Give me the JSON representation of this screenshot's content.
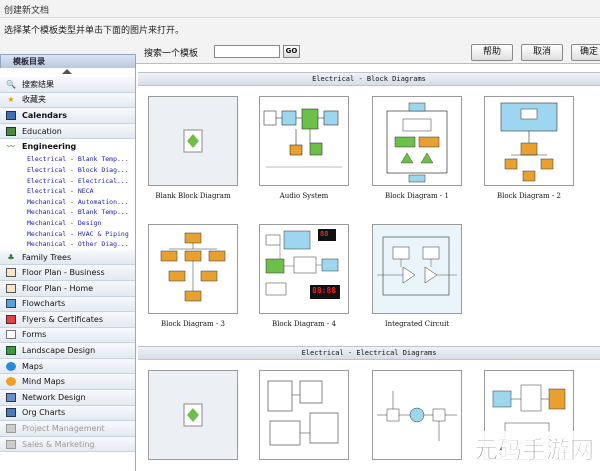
{
  "window": {
    "title": "创建新文档",
    "instruction": "选择某个模板类型并单击下面的图片来打开。"
  },
  "toolbar": {
    "template_dir_label": "模板目录",
    "search_label": "搜索一个模板",
    "search_value": "",
    "go_label": "GO",
    "help_label": "帮助",
    "cancel_label": "取消",
    "ok_label": "确定"
  },
  "sidebar": {
    "top_items": [
      {
        "label": "搜索结果",
        "icon": "magnifier-icon"
      },
      {
        "label": "收藏夹",
        "icon": "star-icon"
      },
      {
        "label": "Calendars",
        "icon": "calendar-icon"
      },
      {
        "label": "Education",
        "icon": "book-icon"
      }
    ],
    "engineering_label": "Engineering",
    "engineering_children": [
      "Electrical - Blank Temp...",
      "Electrical - Block Diag...",
      "Electrical - Electrical...",
      "Electrical - NECA",
      "Mechanical - Automation...",
      "Mechanical - Blank Temp...",
      "Mechanical - Design",
      "Mechanical - HVAC & Piping",
      "Mechanical - Other Diag..."
    ],
    "bottom_items": [
      {
        "label": "Family Trees",
        "icon": "tree-icon"
      },
      {
        "label": "Floor Plan - Business",
        "icon": "floorplan-icon"
      },
      {
        "label": "Floor Plan - Home",
        "icon": "floorplan-icon"
      },
      {
        "label": "Flowcharts",
        "icon": "flowchart-icon"
      },
      {
        "label": "Flyers & Certificates",
        "icon": "flyer-icon"
      },
      {
        "label": "Forms",
        "icon": "form-icon"
      },
      {
        "label": "Landscape Design",
        "icon": "landscape-icon"
      },
      {
        "label": "Maps",
        "icon": "globe-icon"
      },
      {
        "label": "Mind Maps",
        "icon": "mindmap-icon"
      },
      {
        "label": "Network Design",
        "icon": "network-icon"
      },
      {
        "label": "Org Charts",
        "icon": "orgchart-icon"
      },
      {
        "label": "Project Management",
        "icon": "project-icon"
      },
      {
        "label": "Sales & Marketing",
        "icon": "sales-icon"
      }
    ]
  },
  "main": {
    "section1": {
      "title": "Electrical - Block Diagrams",
      "templates": [
        "Blank Block Diagram",
        "Audio System",
        "Block Diagram - 1",
        "Block Diagram - 2",
        "Block Diagram - 3",
        "Block Diagram - 4",
        "Integrated Circuit"
      ]
    },
    "section2": {
      "title": "Electrical - Electrical Diagrams"
    },
    "clock_digits": [
      "88",
      "88:88"
    ]
  },
  "watermark": "元码手游网"
}
